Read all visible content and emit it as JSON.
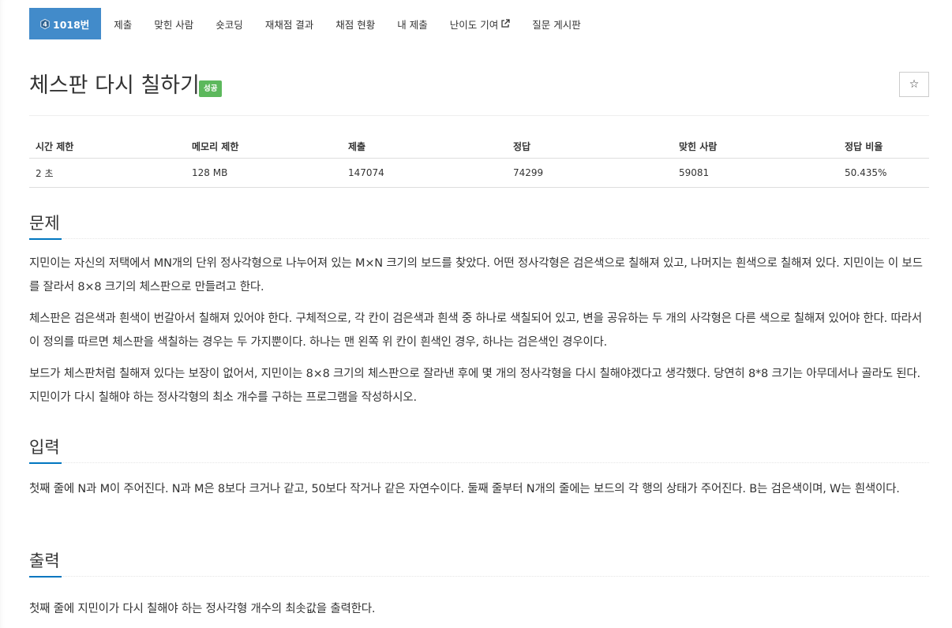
{
  "nav": {
    "tabs": [
      {
        "label": "1018번",
        "active": true
      },
      {
        "label": "제출"
      },
      {
        "label": "맞힌 사람"
      },
      {
        "label": "숏코딩"
      },
      {
        "label": "재채점 결과"
      },
      {
        "label": "채점 현황"
      },
      {
        "label": "내 제출"
      },
      {
        "label": "난이도 기여"
      },
      {
        "label": "질문 게시판"
      }
    ],
    "tier_number": "4"
  },
  "problem": {
    "title": "체스판 다시 칠하기",
    "status_badge": "성공",
    "star_icon": "☆"
  },
  "info_table": {
    "headers": [
      "시간 제한",
      "메모리 제한",
      "제출",
      "정답",
      "맞힌 사람",
      "정답 비율"
    ],
    "values": [
      "2 초",
      "128 MB",
      "147074",
      "74299",
      "59081",
      "50.435%"
    ]
  },
  "sections": {
    "description": {
      "title": "문제",
      "paragraphs": [
        "지민이는 자신의 저택에서 MN개의 단위 정사각형으로 나누어져 있는 M×N 크기의 보드를 찾았다. 어떤 정사각형은 검은색으로 칠해져 있고, 나머지는 흰색으로 칠해져 있다. 지민이는 이 보드를 잘라서 8×8 크기의 체스판으로 만들려고 한다.",
        "체스판은 검은색과 흰색이 번갈아서 칠해져 있어야 한다. 구체적으로, 각 칸이 검은색과 흰색 중 하나로 색칠되어 있고, 변을 공유하는 두 개의 사각형은 다른 색으로 칠해져 있어야 한다. 따라서 이 정의를 따르면 체스판을 색칠하는 경우는 두 가지뿐이다. 하나는 맨 왼쪽 위 칸이 흰색인 경우, 하나는 검은색인 경우이다.",
        "보드가 체스판처럼 칠해져 있다는 보장이 없어서, 지민이는 8×8 크기의 체스판으로 잘라낸 후에 몇 개의 정사각형을 다시 칠해야겠다고 생각했다. 당연히 8*8 크기는 아무데서나 골라도 된다. 지민이가 다시 칠해야 하는 정사각형의 최소 개수를 구하는 프로그램을 작성하시오."
      ]
    },
    "input": {
      "title": "입력",
      "paragraphs": [
        "첫째 줄에 N과 M이 주어진다. N과 M은 8보다 크거나 같고, 50보다 작거나 같은 자연수이다. 둘째 줄부터 N개의 줄에는 보드의 각 행의 상태가 주어진다. B는 검은색이며, W는 흰색이다."
      ]
    },
    "output": {
      "title": "출력",
      "paragraphs": [
        "첫째 줄에 지민이가 다시 칠해야 하는 정사각형 개수의 최솟값을 출력한다."
      ]
    }
  },
  "colors": {
    "active_tab": "#428bca",
    "badge_success": "#5cb85c",
    "section_underline": "#0076c0"
  }
}
